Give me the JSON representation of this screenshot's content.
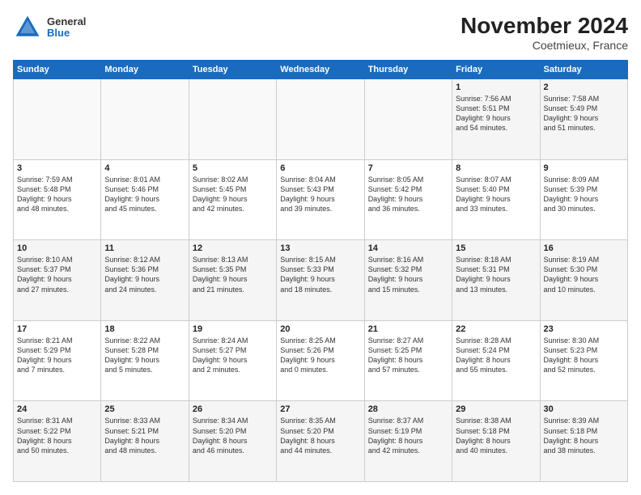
{
  "header": {
    "logo_general": "General",
    "logo_blue": "Blue",
    "month_title": "November 2024",
    "location": "Coetmieux, France"
  },
  "weekdays": [
    "Sunday",
    "Monday",
    "Tuesday",
    "Wednesday",
    "Thursday",
    "Friday",
    "Saturday"
  ],
  "weeks": [
    [
      {
        "day": "",
        "info": ""
      },
      {
        "day": "",
        "info": ""
      },
      {
        "day": "",
        "info": ""
      },
      {
        "day": "",
        "info": ""
      },
      {
        "day": "",
        "info": ""
      },
      {
        "day": "1",
        "info": "Sunrise: 7:56 AM\nSunset: 5:51 PM\nDaylight: 9 hours\nand 54 minutes."
      },
      {
        "day": "2",
        "info": "Sunrise: 7:58 AM\nSunset: 5:49 PM\nDaylight: 9 hours\nand 51 minutes."
      }
    ],
    [
      {
        "day": "3",
        "info": "Sunrise: 7:59 AM\nSunset: 5:48 PM\nDaylight: 9 hours\nand 48 minutes."
      },
      {
        "day": "4",
        "info": "Sunrise: 8:01 AM\nSunset: 5:46 PM\nDaylight: 9 hours\nand 45 minutes."
      },
      {
        "day": "5",
        "info": "Sunrise: 8:02 AM\nSunset: 5:45 PM\nDaylight: 9 hours\nand 42 minutes."
      },
      {
        "day": "6",
        "info": "Sunrise: 8:04 AM\nSunset: 5:43 PM\nDaylight: 9 hours\nand 39 minutes."
      },
      {
        "day": "7",
        "info": "Sunrise: 8:05 AM\nSunset: 5:42 PM\nDaylight: 9 hours\nand 36 minutes."
      },
      {
        "day": "8",
        "info": "Sunrise: 8:07 AM\nSunset: 5:40 PM\nDaylight: 9 hours\nand 33 minutes."
      },
      {
        "day": "9",
        "info": "Sunrise: 8:09 AM\nSunset: 5:39 PM\nDaylight: 9 hours\nand 30 minutes."
      }
    ],
    [
      {
        "day": "10",
        "info": "Sunrise: 8:10 AM\nSunset: 5:37 PM\nDaylight: 9 hours\nand 27 minutes."
      },
      {
        "day": "11",
        "info": "Sunrise: 8:12 AM\nSunset: 5:36 PM\nDaylight: 9 hours\nand 24 minutes."
      },
      {
        "day": "12",
        "info": "Sunrise: 8:13 AM\nSunset: 5:35 PM\nDaylight: 9 hours\nand 21 minutes."
      },
      {
        "day": "13",
        "info": "Sunrise: 8:15 AM\nSunset: 5:33 PM\nDaylight: 9 hours\nand 18 minutes."
      },
      {
        "day": "14",
        "info": "Sunrise: 8:16 AM\nSunset: 5:32 PM\nDaylight: 9 hours\nand 15 minutes."
      },
      {
        "day": "15",
        "info": "Sunrise: 8:18 AM\nSunset: 5:31 PM\nDaylight: 9 hours\nand 13 minutes."
      },
      {
        "day": "16",
        "info": "Sunrise: 8:19 AM\nSunset: 5:30 PM\nDaylight: 9 hours\nand 10 minutes."
      }
    ],
    [
      {
        "day": "17",
        "info": "Sunrise: 8:21 AM\nSunset: 5:29 PM\nDaylight: 9 hours\nand 7 minutes."
      },
      {
        "day": "18",
        "info": "Sunrise: 8:22 AM\nSunset: 5:28 PM\nDaylight: 9 hours\nand 5 minutes."
      },
      {
        "day": "19",
        "info": "Sunrise: 8:24 AM\nSunset: 5:27 PM\nDaylight: 9 hours\nand 2 minutes."
      },
      {
        "day": "20",
        "info": "Sunrise: 8:25 AM\nSunset: 5:26 PM\nDaylight: 9 hours\nand 0 minutes."
      },
      {
        "day": "21",
        "info": "Sunrise: 8:27 AM\nSunset: 5:25 PM\nDaylight: 8 hours\nand 57 minutes."
      },
      {
        "day": "22",
        "info": "Sunrise: 8:28 AM\nSunset: 5:24 PM\nDaylight: 8 hours\nand 55 minutes."
      },
      {
        "day": "23",
        "info": "Sunrise: 8:30 AM\nSunset: 5:23 PM\nDaylight: 8 hours\nand 52 minutes."
      }
    ],
    [
      {
        "day": "24",
        "info": "Sunrise: 8:31 AM\nSunset: 5:22 PM\nDaylight: 8 hours\nand 50 minutes."
      },
      {
        "day": "25",
        "info": "Sunrise: 8:33 AM\nSunset: 5:21 PM\nDaylight: 8 hours\nand 48 minutes."
      },
      {
        "day": "26",
        "info": "Sunrise: 8:34 AM\nSunset: 5:20 PM\nDaylight: 8 hours\nand 46 minutes."
      },
      {
        "day": "27",
        "info": "Sunrise: 8:35 AM\nSunset: 5:20 PM\nDaylight: 8 hours\nand 44 minutes."
      },
      {
        "day": "28",
        "info": "Sunrise: 8:37 AM\nSunset: 5:19 PM\nDaylight: 8 hours\nand 42 minutes."
      },
      {
        "day": "29",
        "info": "Sunrise: 8:38 AM\nSunset: 5:18 PM\nDaylight: 8 hours\nand 40 minutes."
      },
      {
        "day": "30",
        "info": "Sunrise: 8:39 AM\nSunset: 5:18 PM\nDaylight: 8 hours\nand 38 minutes."
      }
    ]
  ]
}
